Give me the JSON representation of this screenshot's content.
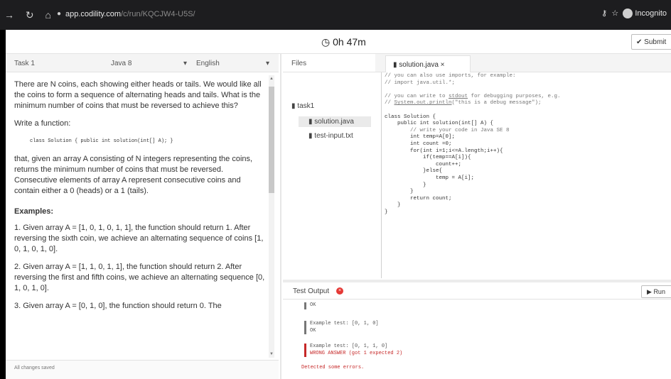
{
  "browser": {
    "url_host": "app.codility.com",
    "url_path": "/c/run/KQCJW4-U5S/",
    "profile_label": "Incognito"
  },
  "header": {
    "timer": "0h 47m",
    "submit_label": "Submit"
  },
  "task_header": {
    "task_label": "Task 1",
    "language": "Java 8",
    "human_language": "English"
  },
  "task": {
    "p1": "There are N coins, each showing either heads or tails. We would like all the coins to form a sequence of alternating heads and tails. What is the minimum number of coins that must be reversed to achieve this?",
    "p2": "Write a function:",
    "signature": "class Solution { public int solution(int[] A); }",
    "p3": "that, given an array A consisting of N integers representing the coins, returns the minimum number of coins that must be reversed. Consecutive elements of array A represent consecutive coins and contain either a 0 (heads) or a 1 (tails).",
    "examples_heading": "Examples:",
    "ex1": "1. Given array A = [1, 0, 1, 0, 1, 1], the function should return 1. After reversing the sixth coin, we achieve an alternating sequence of coins [1, 0, 1, 0, 1, 0].",
    "ex2": "2. Given array A = [1, 1, 0, 1, 1], the function should return 2. After reversing the first and fifth coins, we achieve an alternating sequence [0, 1, 0, 1, 0].",
    "ex3": "3. Given array A = [0, 1, 0], the function should return 0. The"
  },
  "status": {
    "text": "All changes saved"
  },
  "files": {
    "header": "Files",
    "folder": "task1",
    "items": [
      "solution.java",
      "test-input.txt"
    ]
  },
  "editor": {
    "tab_label": "solution.java",
    "lines": {
      "l1": "// you can also use imports, for example:",
      "l2": "// import java.util.*;",
      "l3": "",
      "l4": "// you can write to ",
      "l4u": "stdout",
      "l4b": " for debugging purposes, e.g.",
      "l5a": "// ",
      "l5u": "System.out.println",
      "l5b": "(\"this is a debug message\");",
      "l6": "",
      "l7": "class Solution {",
      "l8": "    public int solution(int[] A) {",
      "l9": "        // write your code in Java SE 8",
      "l10": "        int temp=A[0];",
      "l11": "        int count =0;",
      "l12": "        for(int i=1;i<=A.length;i++){",
      "l13": "            if(temp==A[i]){",
      "l14": "                count++;",
      "l15": "            }else{",
      "l16": "                temp = A[i];",
      "l17": "            }",
      "l18": "        }",
      "l19": "        return count;",
      "l20": "    }",
      "l21": "}"
    }
  },
  "output": {
    "header": "Test Output",
    "run_label": "Run",
    "ok1": "OK",
    "ex2_title": "Example test:   [0, 1, 0]",
    "ok2": "OK",
    "ex3_title": "Example test:   [0, 1, 1, 0]",
    "ex3_result": "WRONG ANSWER (got 1 expected 2)",
    "summary": "Detected some errors."
  }
}
